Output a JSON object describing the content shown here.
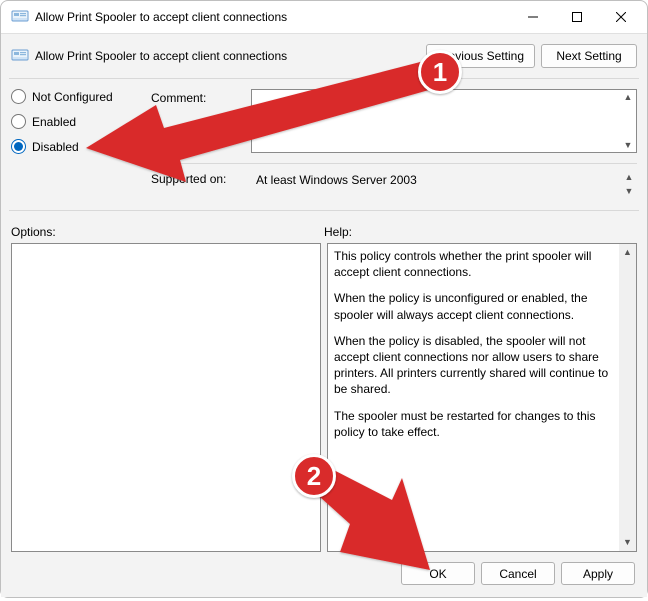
{
  "titlebar": {
    "title": "Allow Print Spooler to accept client connections"
  },
  "header": {
    "setting_title": "Allow Print Spooler to accept client connections",
    "prev_label": "Previous Setting",
    "next_label": "Next Setting"
  },
  "radios": {
    "not_configured": "Not Configured",
    "enabled": "Enabled",
    "disabled": "Disabled"
  },
  "fields": {
    "comment_label": "Comment:",
    "comment_value": "",
    "supported_label": "Supported on:",
    "supported_value": "At least Windows Server 2003"
  },
  "lower": {
    "options_label": "Options:",
    "help_label": "Help:",
    "help_p1": "This policy controls whether the print spooler will accept client connections.",
    "help_p2": "When the policy is unconfigured or enabled, the spooler will always accept client connections.",
    "help_p3": "When the policy is disabled, the spooler will not accept client connections nor allow users to share printers.  All printers currently shared will continue to be shared.",
    "help_p4": "The spooler must be restarted for changes to this policy to take effect."
  },
  "buttons": {
    "ok": "OK",
    "cancel": "Cancel",
    "apply": "Apply"
  },
  "annotations": {
    "badge1": "1",
    "badge2": "2"
  }
}
